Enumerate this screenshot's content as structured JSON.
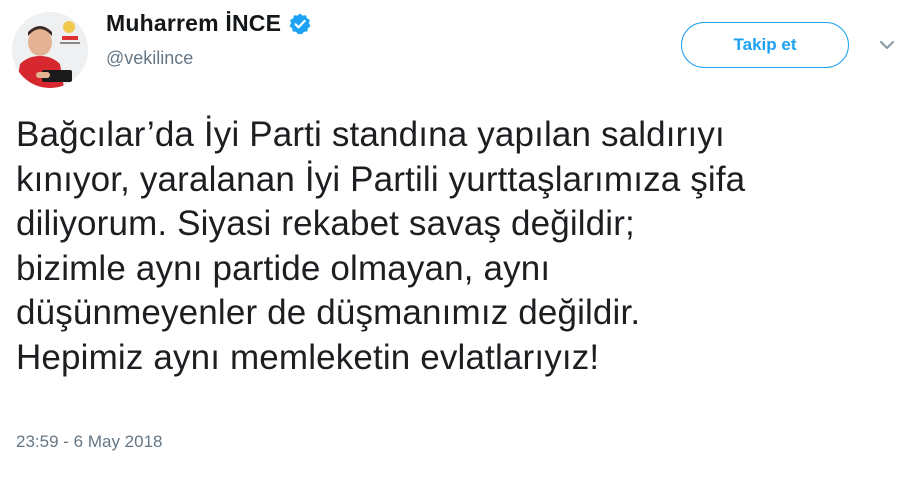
{
  "user": {
    "display_name": "Muharrem İNCE",
    "handle": "@vekilince",
    "verified": true
  },
  "actions": {
    "follow_label": "Takip et"
  },
  "tweet": {
    "text": "Bağcılar’da İyi Parti standına yapılan saldırıyı\nkınıyor, yaralanan İyi Partili yurttaşlarımıza şifa\ndiliyorum. Siyasi rekabet savaş değildir;\nbizimle aynı partide olmayan, aynı\ndüşünmeyenler de düşmanımız değildir.\nHepimiz aynı memleketin evlatlarıyız!",
    "timestamp": "23:59 - 6 May 2018"
  },
  "icons": {
    "verified": "verified-badge-icon",
    "menu": "chevron-down-icon"
  },
  "colors": {
    "accent": "#1da1f2",
    "secondary_text": "#657786",
    "primary_text": "#14171a"
  }
}
